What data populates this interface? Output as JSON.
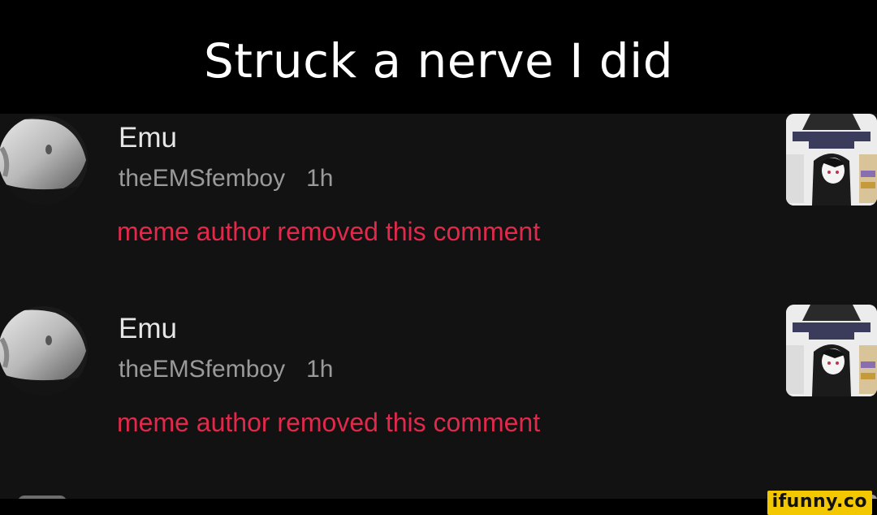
{
  "caption": "Struck a nerve I did",
  "comments": [
    {
      "username": "Emu",
      "handle": "theEMSfemboy",
      "time": "1h",
      "status": "meme author removed this comment"
    },
    {
      "username": "Emu",
      "handle": "theEMSfemboy",
      "time": "1h",
      "status": "meme author removed this comment"
    }
  ],
  "watermark": "ifunny.co",
  "colors": {
    "background": "#000000",
    "panel": "#121212",
    "username": "#e6e6e6",
    "meta": "#9a9a9a",
    "removed": "#e0294b",
    "watermark_bg": "#f4c800"
  },
  "icons": {
    "avatar": "user-avatar-photo",
    "thumbnail": "meme-thumbnail"
  }
}
